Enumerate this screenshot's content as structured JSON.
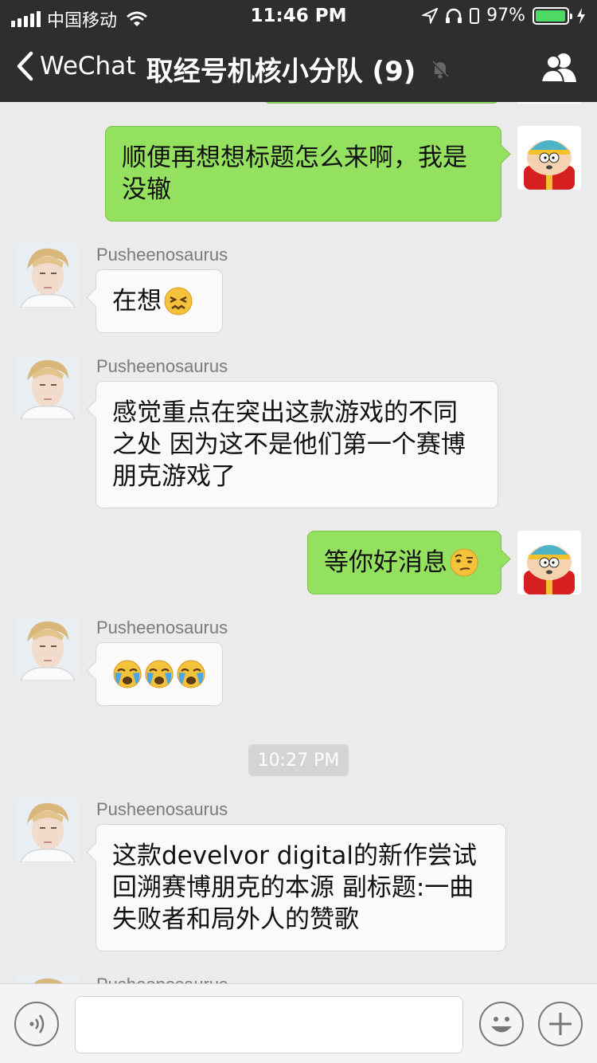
{
  "status_bar": {
    "carrier": "中国移动",
    "time": "11:46 PM",
    "battery_percent": "97%",
    "battery_level": 0.97
  },
  "nav": {
    "back_label": "WeChat",
    "title": "取经号机核小分队 (9)"
  },
  "messages": [
    {
      "side": "right",
      "text": "顺便再想想标题怎么来啊，我是没辙"
    },
    {
      "side": "left",
      "sender": "Pusheenosaurus",
      "text": "在想",
      "emoji": "confounded-face"
    },
    {
      "side": "left",
      "sender": "Pusheenosaurus",
      "text": "感觉重点在突出这款游戏的不同之处 因为这不是他们第一个赛博朋克游戏了"
    },
    {
      "side": "right",
      "text": "等你好消息",
      "emoji": "raised-eyebrow-face"
    },
    {
      "side": "left",
      "sender": "Pusheenosaurus",
      "emoji": [
        "crying-face",
        "crying-face",
        "crying-face"
      ]
    },
    {
      "timestamp": "10:27 PM"
    },
    {
      "side": "left",
      "sender": "Pusheenosaurus",
      "text": "这款develvor digital的新作尝试回溯赛博朋克的本源 副标题:一曲失败者和局外人的赞歌"
    },
    {
      "side": "left",
      "sender": "Pusheenosaurus"
    }
  ],
  "icons": {
    "back": "chevron-left-icon",
    "mute": "mute-bell-icon",
    "group": "group-people-icon",
    "voice": "voice-icon",
    "emoji": "smiley-icon",
    "more": "plus-icon"
  },
  "colors": {
    "nav_bg": "#2e2e30",
    "chat_bg": "#ebebeb",
    "outgoing_bubble": "#94e05f",
    "incoming_bubble": "#fafafa",
    "battery": "#4cd964"
  }
}
